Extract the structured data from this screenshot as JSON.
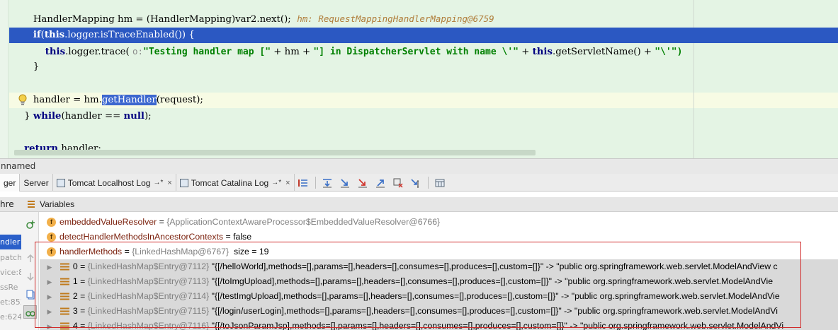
{
  "editor": {
    "lines": {
      "l1_code": "HandlerMapping hm = (HandlerMapping)var2.next();",
      "l1_inline": "hm: RequestMappingHandlerMapping@6759",
      "l2_kw": "if",
      "l2_this": "this",
      "l2_rest": ".logger.isTraceEnabled()) {",
      "l3_this": "this",
      "l3_mid": ".logger.trace(",
      "l3_hint": "o:",
      "l3_str1": "\"Testing handler map [\"",
      "l3_plus1": " + hm + ",
      "l3_str2": "\"] in DispatcherServlet with name \\'\"",
      "l3_plus2": " + ",
      "l3_this2": "this",
      "l3_rest": ".getServletName() + ",
      "l3_str3": "\"\\'\")",
      "l4_brace": "}",
      "l6_pre": "handler = hm.",
      "l6_sel": "getHandler",
      "l6_post": "(request);",
      "l7_brace": "} ",
      "l7_kw": "while",
      "l7_mid": "(handler == ",
      "l7_null": "null",
      "l7_end": ");",
      "l9_kw": "return",
      "l9_rest": " handler;"
    }
  },
  "toolwindow": {
    "title": "nnamed"
  },
  "tabs": {
    "debugger": "ger",
    "server": "Server",
    "localhost_log": "Tomcat Localhost Log",
    "catalina_log": "Tomcat Catalina Log",
    "arrow": "→*",
    "close": "×"
  },
  "frames": {
    "header": "hre",
    "rows": [
      "ndler",
      "patch",
      "vice:8",
      "ssRe",
      "et:852",
      "e:624"
    ]
  },
  "variables": {
    "header": "Variables",
    "rows": [
      {
        "name": "embeddedValueResolver",
        "eq": " = ",
        "type": "{ApplicationContextAwareProcessor$EmbeddedValueResolver@6766}"
      },
      {
        "name": "detectHandlerMethodsInAncestorContexts",
        "eq": " = ",
        "value": "false"
      },
      {
        "name": "handlerMethods",
        "eq": " = ",
        "type": "{LinkedHashMap@6767}",
        "size": "  size = 19"
      }
    ],
    "entries": [
      {
        "idx": "0",
        "type": "{LinkedHashMap$Entry@7112}",
        "key": " \"{[/helloWorld],methods=[],params=[],headers=[],consumes=[],produces=[],custom=[]}\"",
        "arrow": " -> ",
        "val": "\"public org.springframework.web.servlet.ModelAndView c"
      },
      {
        "idx": "1",
        "type": "{LinkedHashMap$Entry@7113}",
        "key": " \"{[/toImgUpload],methods=[],params=[],headers=[],consumes=[],produces=[],custom=[]}\"",
        "arrow": " -> ",
        "val": "\"public org.springframework.web.servlet.ModelAndVie"
      },
      {
        "idx": "2",
        "type": "{LinkedHashMap$Entry@7114}",
        "key": " \"{[/testImgUpload],methods=[],params=[],headers=[],consumes=[],produces=[],custom=[]}\"",
        "arrow": " -> ",
        "val": "\"public org.springframework.web.servlet.ModelAndVie"
      },
      {
        "idx": "3",
        "type": "{LinkedHashMap$Entry@7115}",
        "key": " \"{[/login/userLogin],methods=[],params=[],headers=[],consumes=[],produces=[],custom=[]}\"",
        "arrow": " -> ",
        "val": "\"public org.springframework.web.servlet.ModelAndVi"
      },
      {
        "idx": "4",
        "type": "{LinkedHashMap$Entry@7116}",
        "key": " \"{[/toJsonParamJsp],methods=[],params=[],headers=[],consumes=[],produces=[],custom=[]}\"",
        "arrow": " -> ",
        "val": "\"public org.springframework.web.servlet.ModelAndVi"
      }
    ]
  },
  "colors": {
    "editor_bg": "#e4f4e4",
    "exec_line": "#2b58c2",
    "keyword": "#000080",
    "string": "#008000",
    "highlight_box": "#d12b2b"
  }
}
